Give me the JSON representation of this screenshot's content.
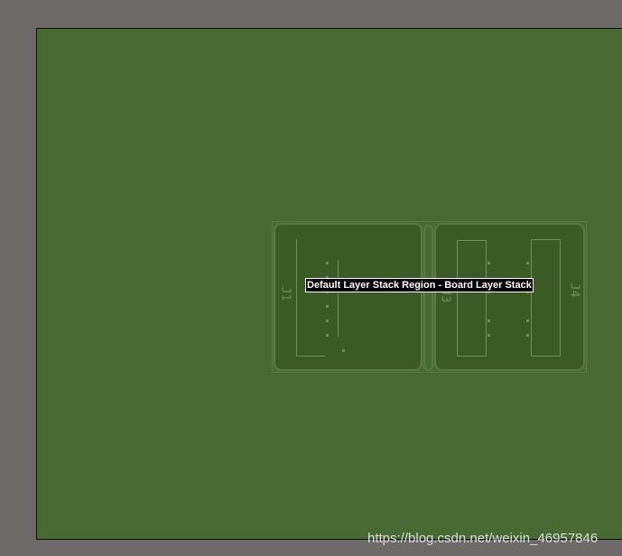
{
  "tooltip": {
    "text": "Default Layer Stack Region - Board Layer Stack"
  },
  "components": {
    "left_designator": "J1",
    "middle_designator": "J3",
    "right_designator": "J4"
  },
  "watermark": {
    "text": "https://blog.csdn.net/weixin_46957846"
  }
}
